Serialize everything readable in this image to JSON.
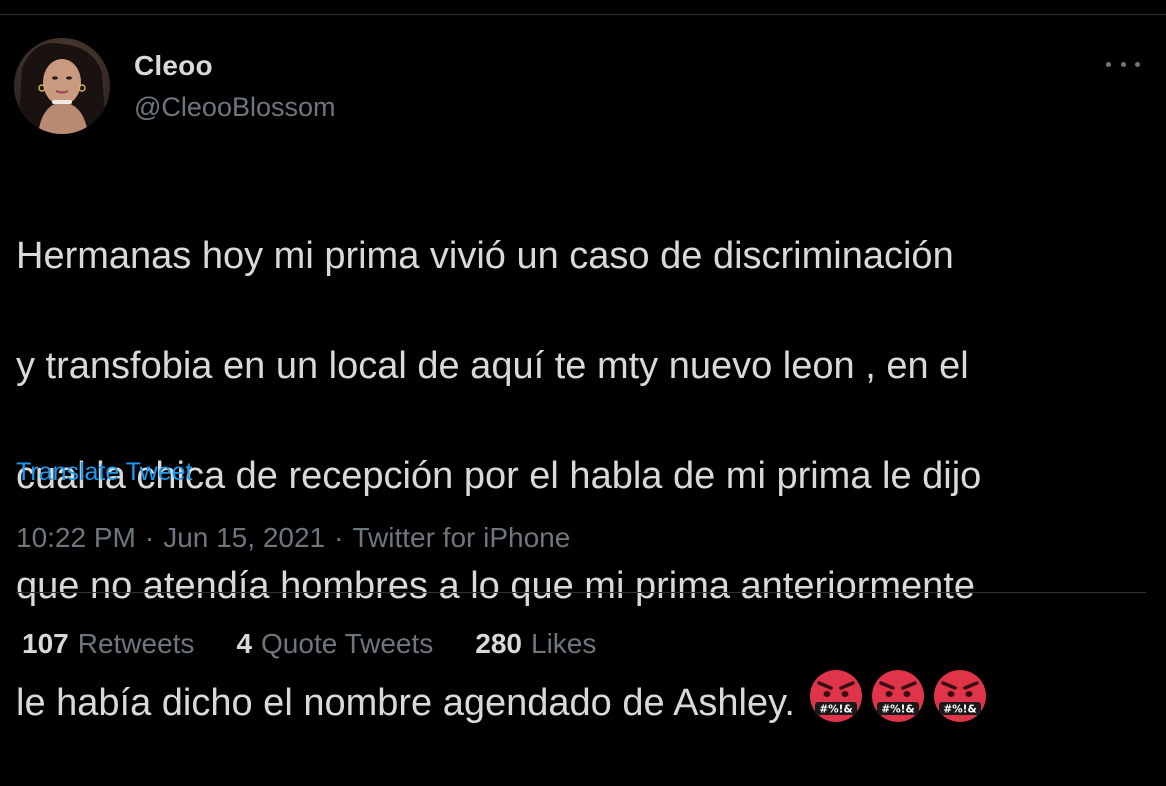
{
  "tweet": {
    "display_name": "Cleoo",
    "handle": "@CleooBlossom",
    "text_lines": [
      "Hermanas hoy mi prima vivió un caso de discriminación",
      "y transfobia en un local de aquí te mty nuevo leon , en el",
      "cual la chica de recepción por el habla de mi prima le dijo",
      "que no atendía hombres a lo que mi prima anteriormente",
      "le había dicho el nombre agendado de Ashley."
    ],
    "emojis": [
      "face-with-symbols-on-mouth-icon",
      "face-with-symbols-on-mouth-icon",
      "face-with-symbols-on-mouth-icon"
    ],
    "emoji_symbols": "#%!&",
    "translate_label": "Translate Tweet",
    "time": "10:22 PM",
    "date": "Jun 15, 2021",
    "source": "Twitter for iPhone",
    "separator": "·"
  },
  "stats": [
    {
      "count": "107",
      "label": "Retweets"
    },
    {
      "count": "4",
      "label": "Quote Tweets"
    },
    {
      "count": "280",
      "label": "Likes"
    }
  ],
  "colors": {
    "background": "#000000",
    "text": "#d9d9d9",
    "secondary": "#6e767d",
    "link": "#1d9bf0",
    "divider": "#2f3336",
    "emoji_red": "#e0344a"
  }
}
